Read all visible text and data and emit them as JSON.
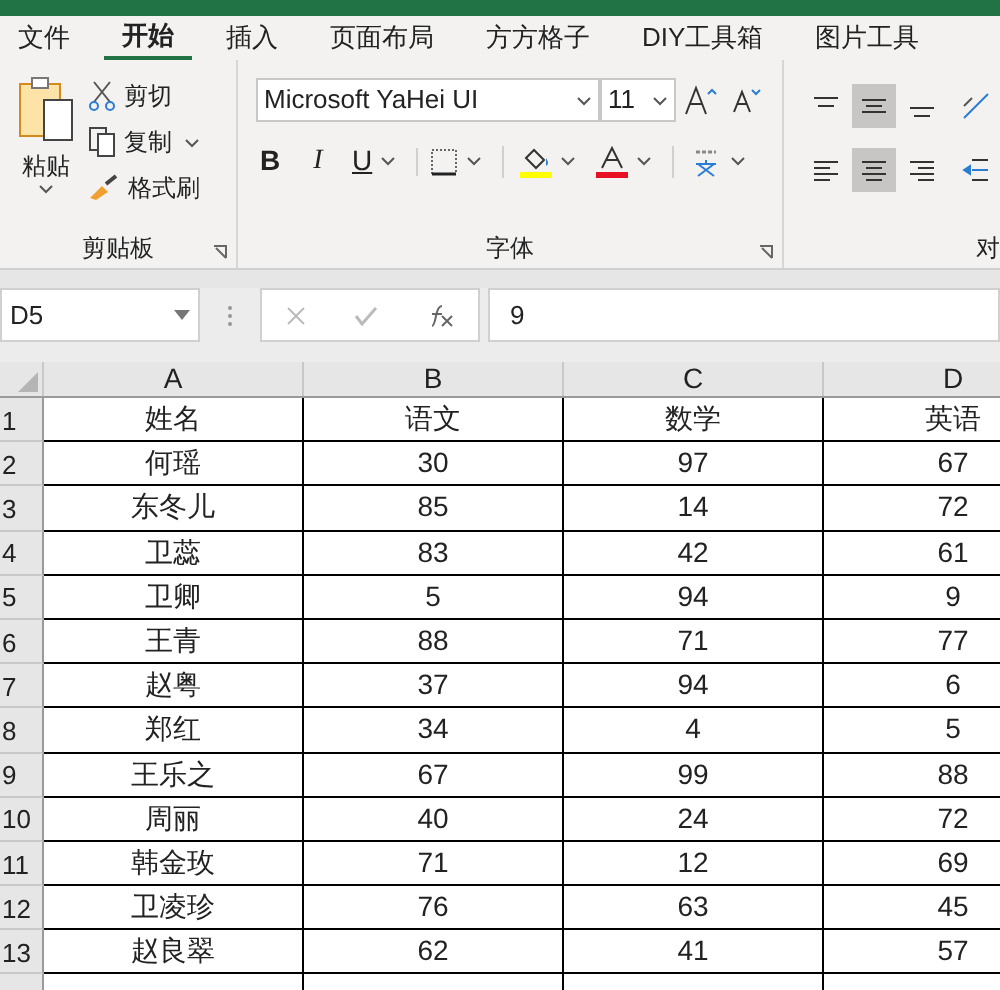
{
  "tabs": [
    {
      "label": "文件",
      "selected": false
    },
    {
      "label": "开始",
      "selected": true
    },
    {
      "label": "插入",
      "selected": false
    },
    {
      "label": "页面布局",
      "selected": false
    },
    {
      "label": "方方格子",
      "selected": false
    },
    {
      "label": "DIY工具箱",
      "selected": false
    },
    {
      "label": "图片工具",
      "selected": false
    }
  ],
  "ribbon": {
    "clipboard": {
      "paste": "粘贴",
      "cut": "剪切",
      "copy": "复制",
      "format_painter": "格式刷",
      "label": "剪贴板"
    },
    "font": {
      "name": "Microsoft YaHei UI",
      "size": "11",
      "bold": "B",
      "italic": "I",
      "underline": "U",
      "label": "字体"
    },
    "alignment": {
      "label": "对"
    }
  },
  "formula_bar": {
    "name_box": "D5",
    "value": "9"
  },
  "sheet": {
    "columns": [
      "A",
      "B",
      "C",
      "D"
    ],
    "rows": [
      {
        "number": "1",
        "cells": [
          "姓名",
          "语文",
          "数学",
          "英语"
        ]
      },
      {
        "number": "2",
        "cells": [
          "何瑶",
          "30",
          "97",
          "67"
        ]
      },
      {
        "number": "3",
        "cells": [
          "东冬儿",
          "85",
          "14",
          "72"
        ]
      },
      {
        "number": "4",
        "cells": [
          "卫蕊",
          "83",
          "42",
          "61"
        ]
      },
      {
        "number": "5",
        "cells": [
          "卫卿",
          "5",
          "94",
          "9"
        ]
      },
      {
        "number": "6",
        "cells": [
          "王青",
          "88",
          "71",
          "77"
        ]
      },
      {
        "number": "7",
        "cells": [
          "赵粤",
          "37",
          "94",
          "6"
        ]
      },
      {
        "number": "8",
        "cells": [
          "郑红",
          "34",
          "4",
          "5"
        ]
      },
      {
        "number": "9",
        "cells": [
          "王乐之",
          "67",
          "99",
          "88"
        ]
      },
      {
        "number": "10",
        "cells": [
          "周丽",
          "40",
          "24",
          "72"
        ]
      },
      {
        "number": "11",
        "cells": [
          "韩金玫",
          "71",
          "12",
          "69"
        ]
      },
      {
        "number": "12",
        "cells": [
          "卫凌珍",
          "76",
          "63",
          "45"
        ]
      },
      {
        "number": "13",
        "cells": [
          "赵良翠",
          "62",
          "41",
          "57"
        ]
      }
    ]
  }
}
